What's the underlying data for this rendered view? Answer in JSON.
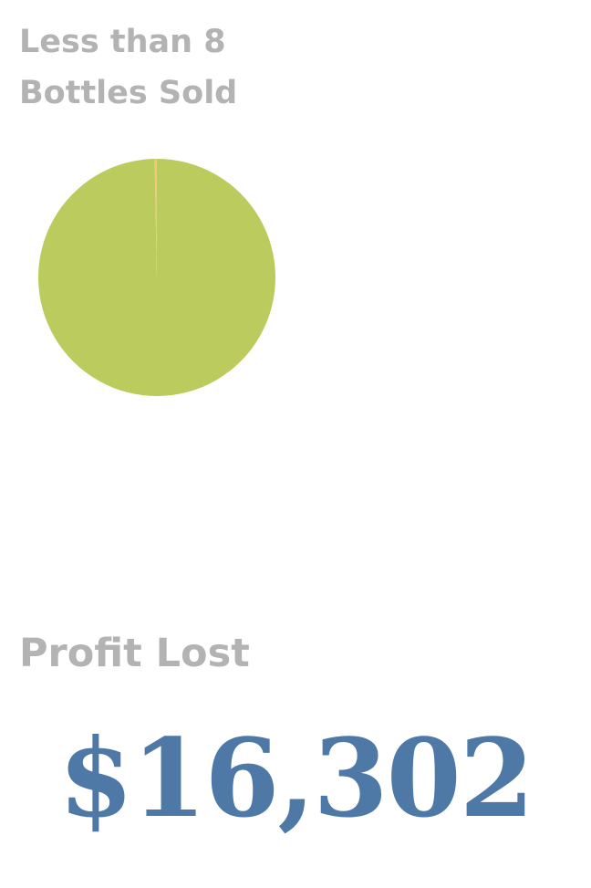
{
  "chart_data": {
    "type": "pie",
    "title": "Less than 8 Bottles Sold",
    "slices": [
      {
        "value": 99.7,
        "color": "#bccb5e"
      },
      {
        "value": 0.3,
        "color": "#f2c879"
      }
    ]
  },
  "profit": {
    "label": "Profit Lost",
    "value": "$16,302"
  }
}
